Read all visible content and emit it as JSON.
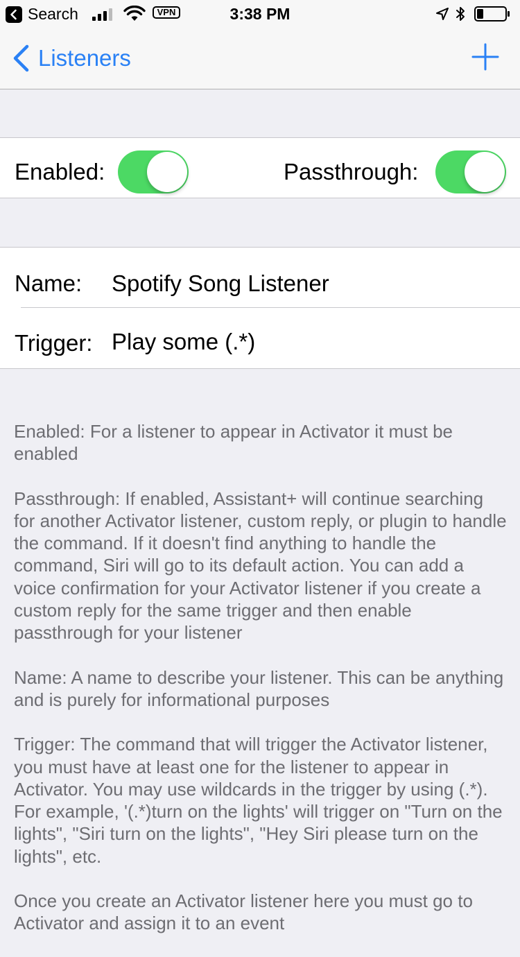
{
  "status_bar": {
    "back_app": "Search",
    "vpn": "VPN",
    "time": "3:38 PM",
    "icons": [
      "back-to-app-icon",
      "signal-icon",
      "wifi-icon",
      "location-icon",
      "bluetooth-icon",
      "battery-icon"
    ]
  },
  "nav": {
    "back_label": "Listeners",
    "icons": [
      "chevron-left-icon",
      "plus-icon"
    ],
    "accent_color": "#2a81f5"
  },
  "toggles": {
    "enabled_label": "Enabled:",
    "enabled_on": true,
    "passthrough_label": "Passthrough:",
    "passthrough_on": true,
    "on_color": "#4cd964"
  },
  "fields": {
    "name_label": "Name:",
    "name_value": "Spotify Song Listener",
    "trigger_label": "Trigger:",
    "trigger_value": "Play some (.*)"
  },
  "help": {
    "p1": "Enabled: For a listener to appear in Activator it must be enabled",
    "p2": "Passthrough: If enabled, Assistant+ will continue searching for another Activator listener, custom reply, or plugin to handle the command. If it doesn't find anything to handle the command, Siri will go to its default action. You can add a voice confirmation for your Activator listener if you create a custom reply for the same trigger and then enable passthrough for your listener",
    "p3": "Name: A name to describe your listener. This can be anything and is purely for informational purposes",
    "p4": "Trigger: The command that will trigger the Activator listener, you must have at least one for the listener to appear in Activator. You may use wildcards in the trigger by using (.*). For example, '(.*)turn on the lights' will trigger on \"Turn on the lights\", \"Siri turn on the lights\", \"Hey Siri please turn on the lights\", etc.",
    "p5": "Once you create an Activator listener here you must go to Activator and assign it to an event"
  }
}
